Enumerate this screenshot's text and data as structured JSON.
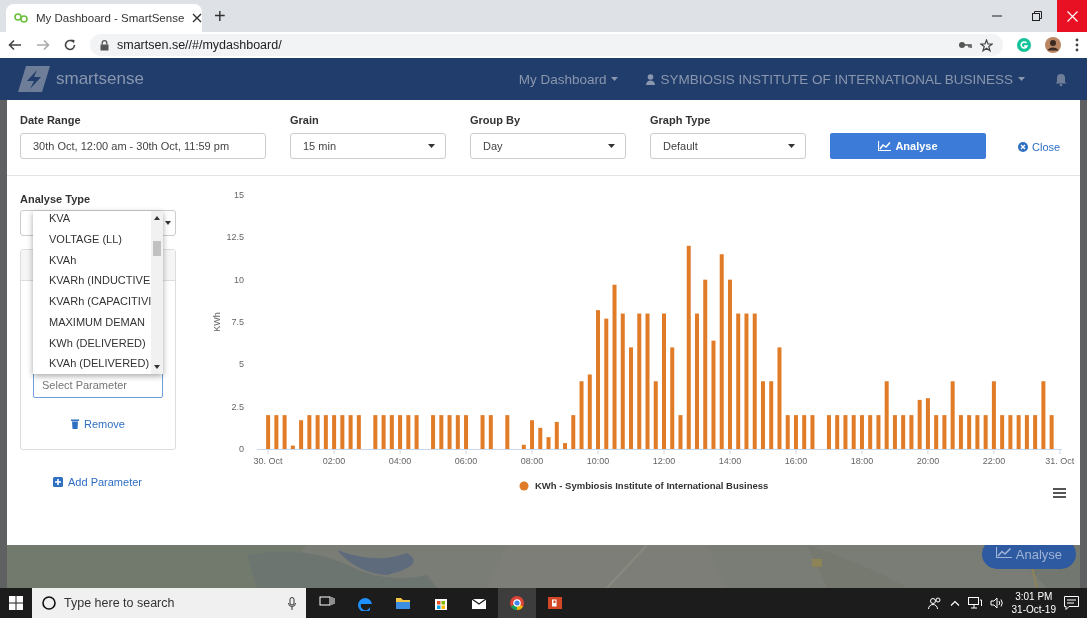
{
  "browser": {
    "tab_title": "My Dashboard - SmartSense",
    "new_tab": "+",
    "url": "smartsen.se//#/mydashboard/"
  },
  "navbar": {
    "logo": "**smart**sense",
    "menu": "My Dashboard",
    "account": "SYMBIOSIS INSTITUTE OF INTERNATIONAL BUSINESS"
  },
  "filters": [
    {
      "kind": "text",
      "label": "Date Range",
      "value": "30th Oct, 12:00 am - 30th Oct, 11:59 pm"
    },
    {
      "kind": "select",
      "label": "Grain",
      "value": "15 min"
    },
    {
      "kind": "select",
      "label": "Group By",
      "value": "Day"
    },
    {
      "kind": "select",
      "label": "Graph Type",
      "value": "Default"
    }
  ],
  "analyse_button": "Analyse",
  "close_button": "Close",
  "analyse_type": {
    "label": "Analyse Type",
    "options": [
      {
        "label": "KVA"
      },
      {
        "label": "VOLTAGE (LL)"
      },
      {
        "label": "KVAh"
      },
      {
        "label": "KVARh (INDUCTIVE"
      },
      {
        "label": "KVARh (CAPACITIVI"
      },
      {
        "label": "MAXIMUM DEMAN"
      },
      {
        "label": "KWh (DELIVERED)"
      },
      {
        "label": "KVAh (DELIVERED)"
      }
    ]
  },
  "parameter": {
    "placeholder": "Select Parameter",
    "remove": "Remove"
  },
  "add_parameter": "Add Parameter",
  "chart_data": {
    "type": "bar",
    "ylabel": "KWh",
    "xlim": [
      -0.125,
      24.125
    ],
    "ylim": [
      0,
      15
    ],
    "yticks": [
      0,
      2.5,
      5,
      7.5,
      10,
      12.5,
      15
    ],
    "xticks": [
      {
        "value": 0,
        "label": "30. Oct"
      },
      {
        "value": 2,
        "label": "02:00"
      },
      {
        "value": 4,
        "label": "04:00"
      },
      {
        "value": 6,
        "label": "06:00"
      },
      {
        "value": 8,
        "label": "08:00"
      },
      {
        "value": 10,
        "label": "10:00"
      },
      {
        "value": 12,
        "label": "12:00"
      },
      {
        "value": 14,
        "label": "14:00"
      },
      {
        "value": 16,
        "label": "16:00"
      },
      {
        "value": 18,
        "label": "18:00"
      },
      {
        "value": 20,
        "label": "20:00"
      },
      {
        "value": 22,
        "label": "22:00"
      },
      {
        "value": 24,
        "label": "31. Oct"
      }
    ],
    "x": [
      0,
      0.25,
      0.5,
      0.75,
      1,
      1.25,
      1.5,
      1.75,
      2,
      2.25,
      2.5,
      2.75,
      3,
      3.25,
      3.5,
      3.75,
      4,
      4.25,
      4.5,
      4.75,
      5,
      5.25,
      5.5,
      5.75,
      6,
      6.25,
      6.5,
      6.75,
      7,
      7.25,
      7.5,
      7.75,
      8,
      8.25,
      8.5,
      8.75,
      9,
      9.25,
      9.5,
      9.75,
      10,
      10.25,
      10.5,
      10.75,
      11,
      11.25,
      11.5,
      11.75,
      12,
      12.25,
      12.5,
      12.75,
      13,
      13.25,
      13.5,
      13.75,
      14,
      14.25,
      14.5,
      14.75,
      15,
      15.25,
      15.5,
      15.75,
      16,
      16.25,
      16.5,
      16.75,
      17,
      17.25,
      17.5,
      17.75,
      18,
      18.25,
      18.5,
      18.75,
      19,
      19.25,
      19.5,
      19.75,
      20,
      20.25,
      20.5,
      20.75,
      21,
      21.25,
      21.5,
      21.75,
      22,
      22.25,
      22.5,
      22.75,
      23,
      23.25,
      23.5,
      23.75
    ],
    "series": [
      {
        "name": "KWh - Symbiosis Institute of International Business",
        "color": "#e07b27",
        "values": [
          2,
          2,
          2,
          0.2,
          1.7,
          2,
          2,
          2,
          2,
          2,
          2,
          2,
          null,
          2,
          2,
          2,
          2,
          2,
          2,
          null,
          2,
          2,
          2,
          2,
          2,
          null,
          2,
          2,
          null,
          2,
          null,
          0.25,
          1.7,
          1.25,
          0.7,
          1.6,
          0.35,
          2,
          4,
          4.4,
          8.2,
          7.7,
          9.7,
          8,
          6,
          8,
          8,
          4,
          8,
          6,
          2,
          12,
          8,
          10,
          6.4,
          11.5,
          10,
          8,
          8,
          8,
          4,
          4,
          6,
          2,
          2,
          2,
          2,
          null,
          2,
          2,
          2,
          2,
          2,
          2,
          2,
          4,
          2,
          2,
          2,
          2.9,
          3,
          2,
          2,
          4,
          2,
          2,
          2,
          2,
          4,
          2,
          2,
          2,
          2,
          2,
          4,
          2
        ]
      }
    ]
  },
  "floating_button": "Analyse",
  "taskbar": {
    "search_placeholder": "Type here to search",
    "time": "3:01 PM",
    "date": "31-Oct-19"
  }
}
